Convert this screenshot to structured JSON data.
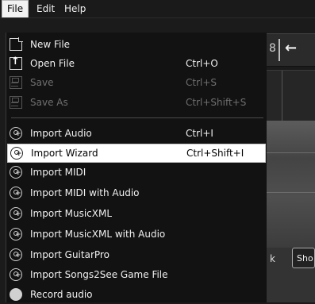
{
  "menubar": {
    "items": [
      {
        "label": "File",
        "open": true
      },
      {
        "label": "Edit",
        "open": false
      },
      {
        "label": "Help",
        "open": false
      }
    ]
  },
  "background": {
    "toolbar_text": "8",
    "partial_label": "k",
    "partial_button": "Sho"
  },
  "file_menu": {
    "items": [
      {
        "label": "New File",
        "shortcut": "",
        "icon": "new-file-icon",
        "enabled": true
      },
      {
        "label": "Open File",
        "shortcut": "Ctrl+O",
        "icon": "open-file-icon",
        "enabled": true
      },
      {
        "label": "Save",
        "shortcut": "Ctrl+S",
        "icon": "save-icon",
        "enabled": false
      },
      {
        "label": "Save As",
        "shortcut": "Ctrl+Shift+S",
        "icon": "save-as-icon",
        "enabled": false
      },
      {
        "label": "Import Audio",
        "shortcut": "Ctrl+I",
        "icon": "import-icon",
        "enabled": true
      },
      {
        "label": "Import Wizard",
        "shortcut": "Ctrl+Shift+I",
        "icon": "import-icon",
        "enabled": true,
        "highlighted": true
      },
      {
        "label": "Import MIDI",
        "shortcut": "",
        "icon": "import-icon",
        "enabled": true
      },
      {
        "label": "Import MIDI with Audio",
        "shortcut": "",
        "icon": "import-icon",
        "enabled": true
      },
      {
        "label": "Import MusicXML",
        "shortcut": "",
        "icon": "import-icon",
        "enabled": true
      },
      {
        "label": "Import MusicXML with Audio",
        "shortcut": "",
        "icon": "import-icon",
        "enabled": true
      },
      {
        "label": "Import GuitarPro",
        "shortcut": "",
        "icon": "import-icon",
        "enabled": true
      },
      {
        "label": "Import Songs2See Game File",
        "shortcut": "",
        "icon": "import-icon",
        "enabled": true
      },
      {
        "label": "Record audio",
        "shortcut": "",
        "icon": "record-icon",
        "enabled": true
      }
    ]
  }
}
